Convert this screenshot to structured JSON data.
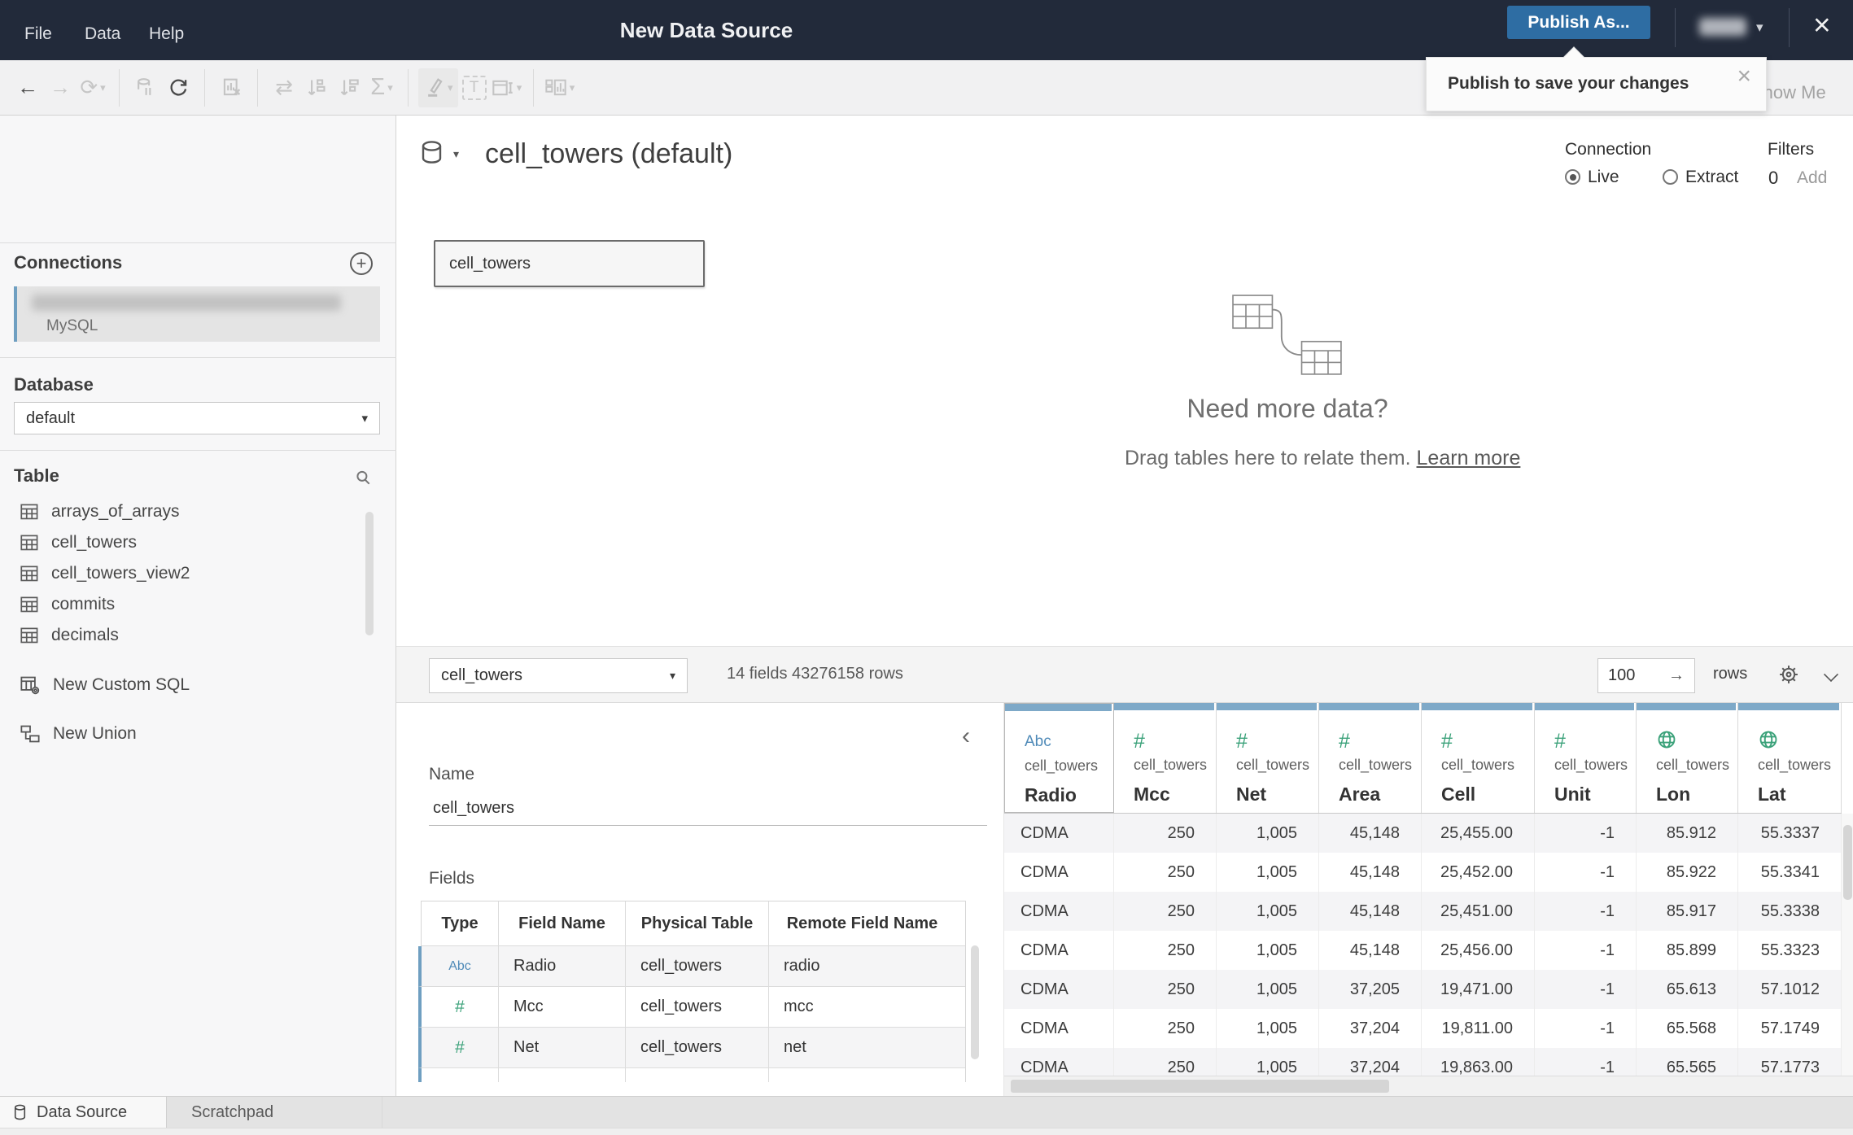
{
  "titlebar": {
    "menu_file": "File",
    "menu_data": "Data",
    "menu_help": "Help",
    "title": "New Data Source",
    "publish_label": "Publish As...",
    "tooltip_text": "Publish to save your changes"
  },
  "toolbar": {
    "show_me": "Show Me"
  },
  "sidebar": {
    "connections_title": "Connections",
    "connection_subtitle": "MySQL",
    "database_title": "Database",
    "database_selected": "default",
    "table_title": "Table",
    "tables": [
      "arrays_of_arrays",
      "cell_towers",
      "cell_towers_view2",
      "commits",
      "decimals"
    ],
    "new_custom_sql": "New Custom SQL",
    "new_union": "New Union"
  },
  "canvas": {
    "datasource_title": "cell_towers (default)",
    "table_box_label": "cell_towers",
    "connection_label": "Connection",
    "live_label": "Live",
    "extract_label": "Extract",
    "filters_label": "Filters",
    "filters_count": "0",
    "filters_add": "Add",
    "empty_heading": "Need more data?",
    "empty_body": "Drag tables here to relate them.",
    "empty_link": "Learn more"
  },
  "metabar": {
    "table_selected": "cell_towers",
    "summary": "14 fields 43276158 rows",
    "row_limit": "100",
    "rows_label": "rows"
  },
  "left_panel": {
    "name_label": "Name",
    "name_value": "cell_towers",
    "fields_label": "Fields",
    "fields_headers": [
      "Type",
      "Field Name",
      "Physical Table",
      "Remote Field Name"
    ],
    "fields_rows": [
      {
        "type": "Abc",
        "field_name": "Radio",
        "physical_table": "cell_towers",
        "remote_field_name": "radio"
      },
      {
        "type": "#",
        "field_name": "Mcc",
        "physical_table": "cell_towers",
        "remote_field_name": "mcc"
      },
      {
        "type": "#",
        "field_name": "Net",
        "physical_table": "cell_towers",
        "remote_field_name": "net"
      }
    ]
  },
  "grid": {
    "columns": [
      {
        "type": "Abc",
        "table": "cell_towers",
        "name": "Radio"
      },
      {
        "type": "#",
        "table": "cell_towers",
        "name": "Mcc"
      },
      {
        "type": "#",
        "table": "cell_towers",
        "name": "Net"
      },
      {
        "type": "#",
        "table": "cell_towers",
        "name": "Area"
      },
      {
        "type": "#",
        "table": "cell_towers",
        "name": "Cell"
      },
      {
        "type": "#",
        "table": "cell_towers",
        "name": "Unit"
      },
      {
        "type": "globe",
        "table": "cell_towers",
        "name": "Lon"
      },
      {
        "type": "globe",
        "table": "cell_towers",
        "name": "Lat"
      }
    ],
    "rows": [
      [
        "CDMA",
        "250",
        "1,005",
        "45,148",
        "25,455.00",
        "-1",
        "85.912",
        "55.3337"
      ],
      [
        "CDMA",
        "250",
        "1,005",
        "45,148",
        "25,452.00",
        "-1",
        "85.922",
        "55.3341"
      ],
      [
        "CDMA",
        "250",
        "1,005",
        "45,148",
        "25,451.00",
        "-1",
        "85.917",
        "55.3338"
      ],
      [
        "CDMA",
        "250",
        "1,005",
        "45,148",
        "25,456.00",
        "-1",
        "85.899",
        "55.3323"
      ],
      [
        "CDMA",
        "250",
        "1,005",
        "37,205",
        "19,471.00",
        "-1",
        "65.613",
        "57.1012"
      ],
      [
        "CDMA",
        "250",
        "1,005",
        "37,204",
        "19,811.00",
        "-1",
        "65.568",
        "57.1749"
      ],
      [
        "CDMA",
        "250",
        "1,005",
        "37,204",
        "19,863.00",
        "-1",
        "65.565",
        "57.1773"
      ]
    ]
  },
  "tabs": {
    "data_source": "Data Source",
    "scratchpad": "Scratchpad"
  },
  "colors": {
    "topbar": "#222a3a",
    "accent_blue": "#7ea9c8",
    "publish_blue": "#2e6da3",
    "type_green": "#3aa179",
    "type_blue": "#4f8ab8"
  }
}
